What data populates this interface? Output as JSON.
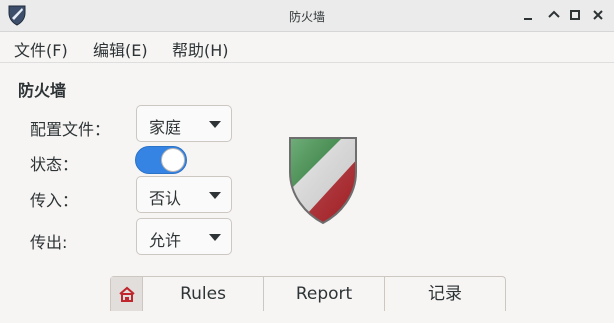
{
  "window": {
    "title": "防火墙",
    "controls": [
      "minimize",
      "maximize",
      "close"
    ]
  },
  "menubar": {
    "items": [
      {
        "label": "文件(F)",
        "key": "F"
      },
      {
        "label": "编辑(E)",
        "key": "E"
      },
      {
        "label": "帮助(H)",
        "key": "H"
      }
    ]
  },
  "main": {
    "section_title": "防火墙",
    "profile": {
      "label": "配置文件：",
      "value": "家庭"
    },
    "status": {
      "label": "状态：",
      "enabled": true
    },
    "incoming": {
      "label": "传入：",
      "value": "否认"
    },
    "outgoing": {
      "label": "传出:",
      "value": "允许"
    }
  },
  "tabs": [
    {
      "icon": "home-icon",
      "label": ""
    },
    {
      "label": "Rules"
    },
    {
      "label": "Report"
    },
    {
      "label": "记录"
    }
  ],
  "colors": {
    "accent": "#3584e4",
    "shield_green": "#2e8b3c",
    "shield_red": "#c0262d"
  }
}
